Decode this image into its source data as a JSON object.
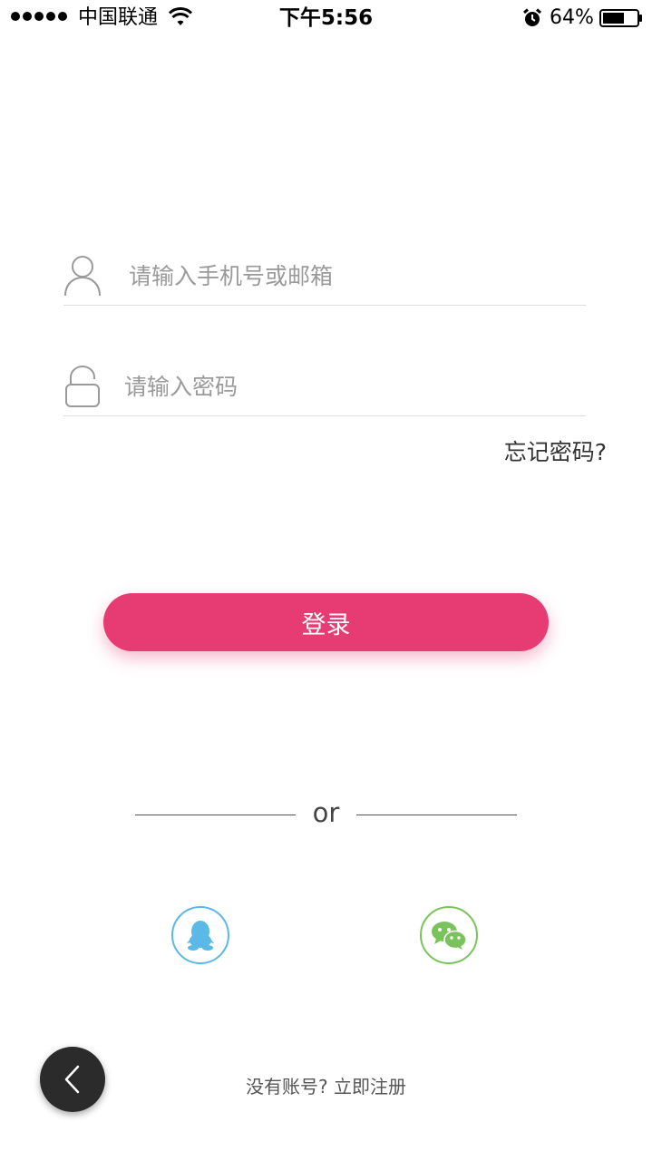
{
  "status_bar": {
    "carrier": "中国联通",
    "time": "下午5:56",
    "battery_percent": "64%",
    "battery_level": 0.64,
    "icons": [
      "signal-dots",
      "wifi-icon",
      "alarm-icon",
      "battery-icon"
    ]
  },
  "login_form": {
    "username_placeholder": "请输入手机号或邮箱",
    "username_icon": "user-icon",
    "password_placeholder": "请输入密码",
    "password_icon": "lock-icon",
    "forgot_password": "忘记密码?",
    "login_button": "登录"
  },
  "divider": {
    "text": "or"
  },
  "social": {
    "qq_icon": "qq-icon",
    "wechat_icon": "wechat-icon"
  },
  "footer": {
    "register_text": "没有账号? 立即注册",
    "back_icon": "chevron-left-icon"
  },
  "colors": {
    "accent": "#e63b73",
    "qq": "#5ab9e6",
    "wechat": "#7ac35c",
    "back_button": "#2b2b2b"
  }
}
